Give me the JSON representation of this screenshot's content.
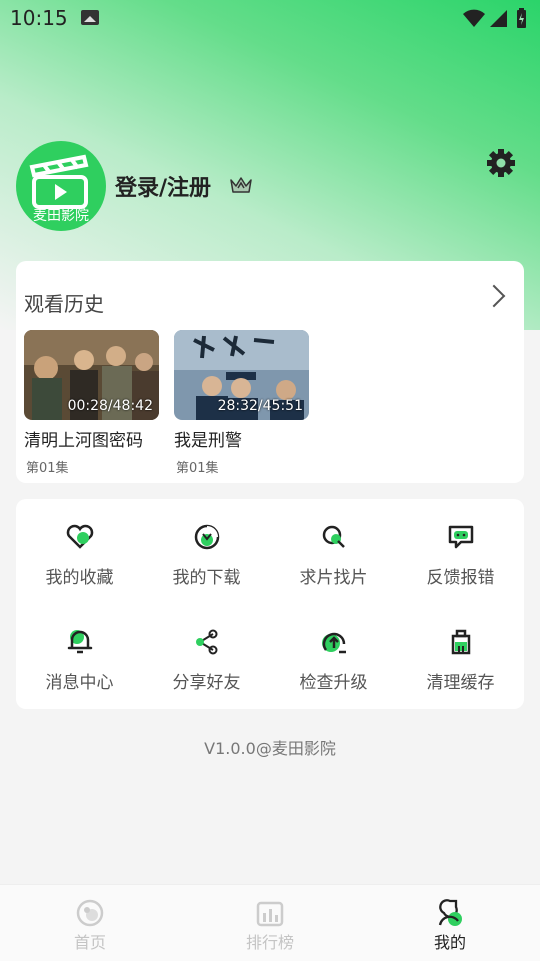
{
  "status_bar": {
    "time": "10:15"
  },
  "profile": {
    "avatar_text": "麦田影院",
    "login_label": "登录/注册"
  },
  "history": {
    "title": "观看历史",
    "items": [
      {
        "title": "清明上河图密码",
        "progress": "00:28/48:42",
        "episode": "第01集"
      },
      {
        "title": "我是刑警",
        "progress": "28:32/45:51",
        "episode": "第01集"
      }
    ]
  },
  "menu": {
    "items": [
      {
        "label": "我的收藏",
        "icon": "heart-icon"
      },
      {
        "label": "我的下载",
        "icon": "download-icon"
      },
      {
        "label": "求片找片",
        "icon": "search-icon"
      },
      {
        "label": "反馈报错",
        "icon": "feedback-icon"
      },
      {
        "label": "消息中心",
        "icon": "bell-icon"
      },
      {
        "label": "分享好友",
        "icon": "share-icon"
      },
      {
        "label": "检查升级",
        "icon": "upgrade-icon"
      },
      {
        "label": "清理缓存",
        "icon": "broom-icon"
      }
    ]
  },
  "version": "V1.0.0@麦田影院",
  "nav": {
    "items": [
      {
        "label": "首页",
        "icon": "home-icon"
      },
      {
        "label": "排行榜",
        "icon": "chart-icon"
      },
      {
        "label": "我的",
        "icon": "profile-icon",
        "active": true
      }
    ]
  },
  "colors": {
    "accent": "#2fcf5f",
    "background": "#f4f4f4"
  }
}
